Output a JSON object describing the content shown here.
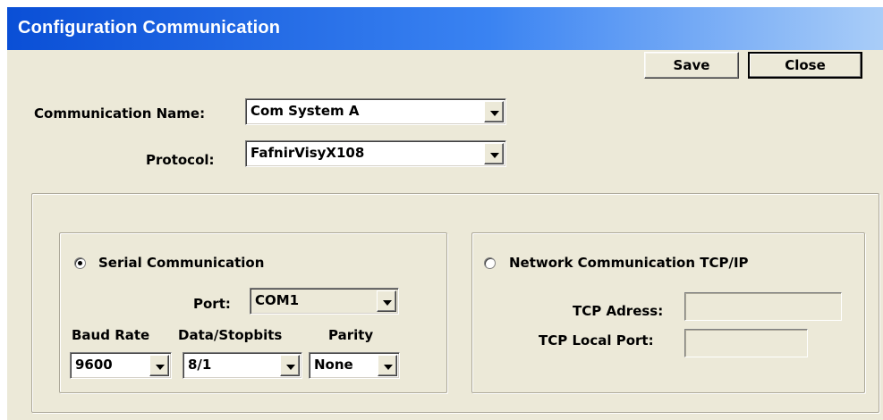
{
  "window": {
    "title": "Configuration Communication"
  },
  "toolbar": {
    "save_label": "Save",
    "close_label": "Close"
  },
  "form": {
    "communication_name_label": "Communication Name:",
    "communication_name_value": "Com System A",
    "protocol_label": "Protocol:",
    "protocol_value": "FafnirVisyX108"
  },
  "serial": {
    "radio_label": "Serial Communication",
    "selected": true,
    "port_label": "Port:",
    "port_value": "COM1",
    "baud_label": "Baud Rate",
    "baud_value": "9600",
    "databits_label": "Data/Stopbits",
    "databits_value": "8/1",
    "parity_label": "Parity",
    "parity_value": "None"
  },
  "network": {
    "radio_label": "Network Communication TCP/IP",
    "selected": false,
    "tcp_address_label": "TCP Adress:",
    "tcp_address_value": "",
    "tcp_local_port_label": "TCP Local Port:",
    "tcp_local_port_value": ""
  }
}
